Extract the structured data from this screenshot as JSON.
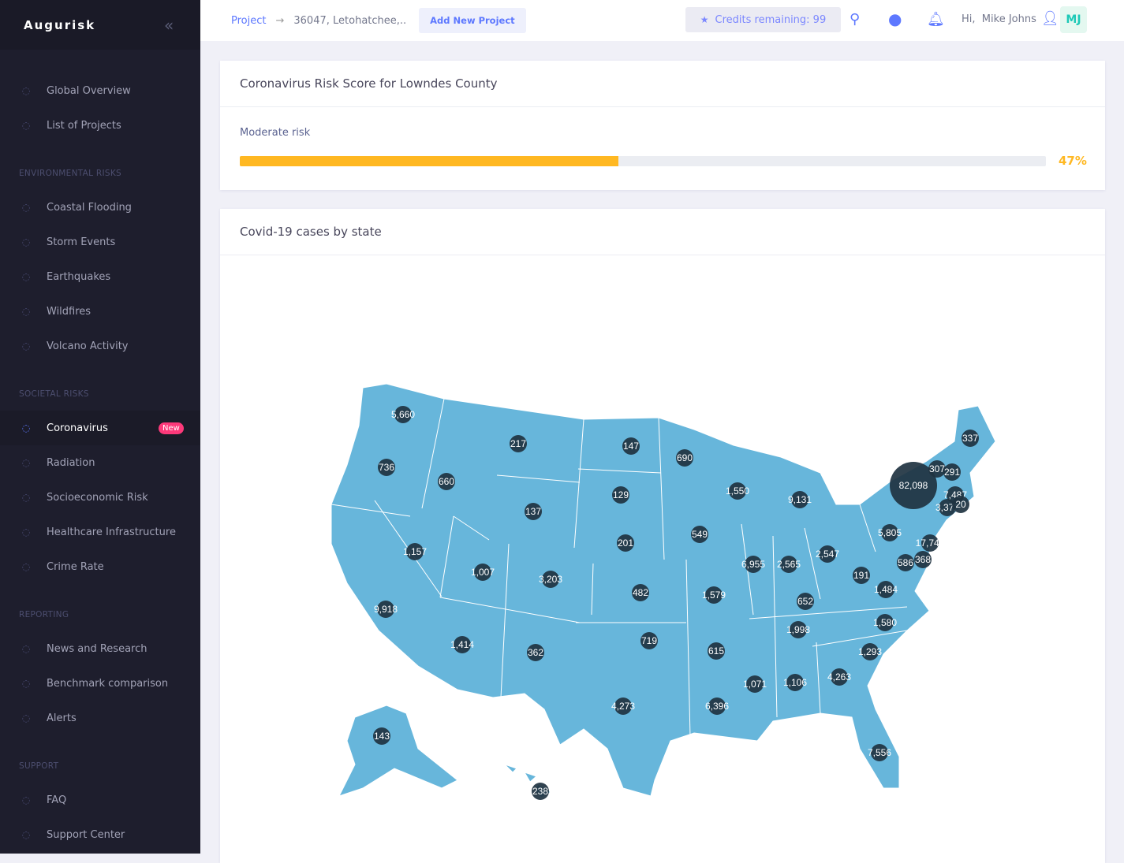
{
  "sidebar": {
    "brand": "Augurisk",
    "top": [
      {
        "label": "Global Overview",
        "icon": "chart-icon"
      },
      {
        "label": "List of Projects",
        "icon": "gear-icon"
      }
    ],
    "sections": [
      {
        "title": "ENVIRONMENTAL RISKS",
        "items": [
          {
            "label": "Coastal Flooding",
            "icon": "arrow-up-icon"
          },
          {
            "label": "Storm Events",
            "icon": "cloud-icon"
          },
          {
            "label": "Earthquakes",
            "icon": "chart-icon"
          },
          {
            "label": "Wildfires",
            "icon": "fire-icon"
          },
          {
            "label": "Volcano Activity",
            "icon": "globe-icon"
          }
        ]
      },
      {
        "title": "SOCIETAL RISKS",
        "items": [
          {
            "label": "Coronavirus",
            "icon": "bug-icon",
            "badge": "New",
            "active": true
          },
          {
            "label": "Radiation",
            "icon": "radiation-icon"
          },
          {
            "label": "Socioeconomic Risk",
            "icon": "bank-icon"
          },
          {
            "label": "Healthcare Infrastructure",
            "icon": "ambulance-icon"
          },
          {
            "label": "Crime Rate",
            "icon": "lock-icon"
          }
        ]
      },
      {
        "title": "REPORTING",
        "items": [
          {
            "label": "News and Research",
            "icon": "checklist-icon"
          },
          {
            "label": "Benchmark comparison",
            "icon": "list-icon"
          },
          {
            "label": "Alerts",
            "icon": "warning-icon"
          }
        ]
      },
      {
        "title": "SUPPORT",
        "items": [
          {
            "label": "FAQ",
            "icon": "document-icon"
          },
          {
            "label": "Support Center",
            "icon": "support-icon"
          }
        ]
      }
    ]
  },
  "header": {
    "breadcrumb": "Project",
    "location": "36047, Letohatchee,..",
    "add_project": "Add New Project",
    "credits": "Credits remaining: 99",
    "greeting": "Hi,",
    "user": "Mike Johns",
    "initials": "MJ"
  },
  "risk": {
    "title": "Coronavirus Risk Score for Lowndes County",
    "level": "Moderate risk",
    "percent": 47,
    "percent_label": "47%",
    "color": "#ffb822"
  },
  "map": {
    "title": "Covid-19 cases by state",
    "fill": "#67b6db",
    "bubble": "#1f3341",
    "values": [
      "5,660",
      "736",
      "660",
      "217",
      "147",
      "690",
      "137",
      "129",
      "1,157",
      "9,918",
      "1,007",
      "3,203",
      "201",
      "549",
      "1,550",
      "9,131",
      "6,955",
      "2,565",
      "2,547",
      "5,805",
      "17,743",
      "82,098",
      "337",
      "307",
      "291",
      "7,487",
      "3,372",
      "20",
      "586",
      "368",
      "191",
      "1,484",
      "652",
      "482",
      "1,579",
      "1,414",
      "362",
      "719",
      "615",
      "1,998",
      "1,580",
      "1,293",
      "4,263",
      "1,071",
      "1,106",
      "6,396",
      "4,273",
      "7,556",
      "143",
      "238"
    ]
  }
}
